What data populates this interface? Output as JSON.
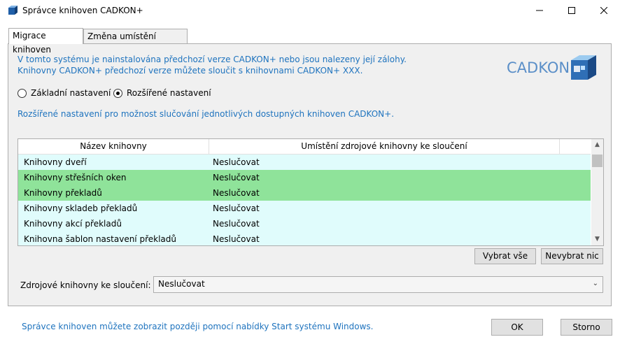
{
  "window": {
    "title": "Správce knihoven CADKON+"
  },
  "tabs": [
    {
      "label": "Migrace knihoven",
      "active": true
    },
    {
      "label": "Změna umístění knihoven",
      "active": false
    }
  ],
  "info": {
    "line1": "V tomto systému je nainstalována předchozí verze CADKON+ nebo jsou nalezeny její zálohy.",
    "line2": "Knihovny CADKON+ předchozí verze můžete sloučit s knihovnami CADKON+ XXX."
  },
  "logo": {
    "text": "CADKON+"
  },
  "radios": [
    {
      "label": "Základní nastavení",
      "checked": false
    },
    {
      "label": "Rozšířené nastavení",
      "checked": true
    }
  ],
  "description": "Rozšířené nastavení pro možnost slučování jednotlivých dostupných knihoven CADKON+.",
  "grid": {
    "columns": [
      "Název knihovny",
      "Umístění zdrojové knihovny ke sloučení"
    ],
    "rows": [
      {
        "name": "Knihovny dveří",
        "source": "Neslučovat",
        "highlight": false
      },
      {
        "name": "Knihovny střešních oken",
        "source": "Neslučovat",
        "highlight": true
      },
      {
        "name": "Knihovny překladů",
        "source": "Neslučovat",
        "highlight": true
      },
      {
        "name": "Knihovny skladeb překladů",
        "source": "Neslučovat",
        "highlight": false
      },
      {
        "name": "Knihovny akcí překladů",
        "source": "Neslučovat",
        "highlight": false
      },
      {
        "name": "Knihovna šablon nastavení překladů",
        "source": "Neslučovat",
        "highlight": false
      }
    ]
  },
  "buttons": {
    "select_all": "Vybrat vše",
    "select_none": "Nevybrat nic",
    "ok": "OK",
    "cancel": "Storno"
  },
  "combo": {
    "label": "Zdrojové knihovny ke sloučení:",
    "value": "Neslučovat"
  },
  "footer": "Správce knihoven můžete zobrazit později pomocí nabídky Start systému Windows.",
  "colors": {
    "accent_text": "#1e73be",
    "row_default": "#e0fcfc",
    "row_highlight": "#8fe39a"
  }
}
